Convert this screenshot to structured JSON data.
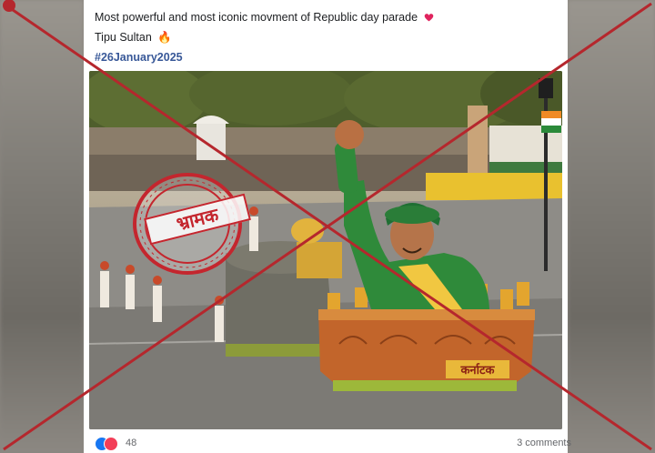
{
  "post": {
    "caption_line1": "Most powerful and most iconic movment of Republic day parade",
    "caption_line2": "Tipu Sultan",
    "hashtag": "#26January2025",
    "reaction_count": "48",
    "comments_label": "3 comments"
  },
  "image": {
    "float_sign": "कर्नाटक",
    "stamp_text": "भ्रामक"
  },
  "colors": {
    "cross": "#b5272d",
    "stamp": "#c4262e",
    "hashtag": "#385898",
    "like": "#1877f2",
    "love": "#f33e58"
  }
}
